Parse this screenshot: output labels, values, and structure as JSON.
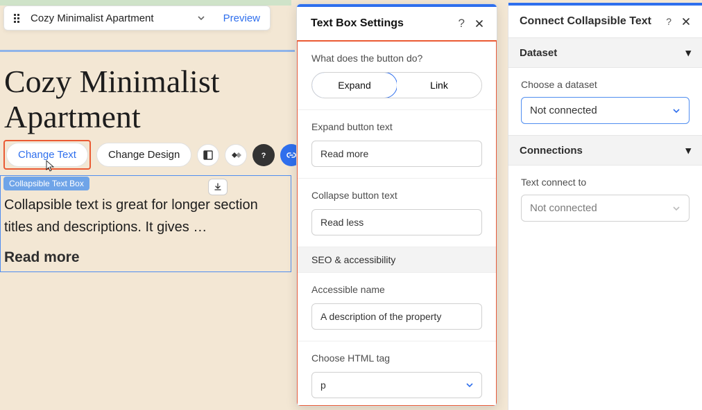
{
  "page_bar": {
    "page_name": "Cozy Minimalist Apartment",
    "preview": "Preview"
  },
  "canvas": {
    "title": "Cozy Minimalist Apartment",
    "toolbar": {
      "change_text": "Change Text",
      "change_design": "Change Design"
    },
    "selection_tag": "Collapsible Text Box",
    "paragraph": "Collapsible text is great for longer section titles and descriptions. It gives …",
    "readmore": "Read more"
  },
  "settings_panel": {
    "title": "Text Box Settings",
    "button_action": {
      "question": "What does the button do?",
      "options": {
        "expand": "Expand",
        "link": "Link"
      }
    },
    "expand_text": {
      "label": "Expand button text",
      "value": "Read more"
    },
    "collapse_text": {
      "label": "Collapse button text",
      "value": "Read less"
    },
    "seo_header": "SEO & accessibility",
    "accessible_name": {
      "label": "Accessible name",
      "value": "A description of the property"
    },
    "html_tag": {
      "label": "Choose HTML tag",
      "value": "p"
    }
  },
  "connect_panel": {
    "title": "Connect Collapsible Text",
    "dataset_header": "Dataset",
    "choose_dataset": {
      "label": "Choose a dataset",
      "value": "Not connected"
    },
    "connections_header": "Connections",
    "text_connects": {
      "label": "Text connect to",
      "value": "Not connected"
    }
  }
}
